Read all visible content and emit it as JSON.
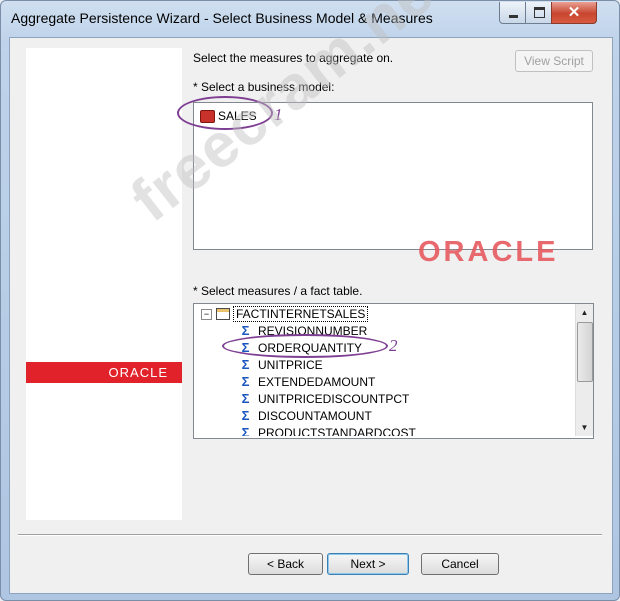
{
  "window": {
    "title": "Aggregate Persistence Wizard - Select Business Model & Measures",
    "controls": {
      "minimize": "minimize-icon",
      "maximize": "maximize-icon",
      "close": "close-icon"
    }
  },
  "left_panel": {
    "brand": "ORACLE",
    "brand_color": "#e2222a"
  },
  "main": {
    "instruction": "Select the measures to aggregate on.",
    "view_script_label": "View Script",
    "business_model_label": "* Select a business model:",
    "business_models": [
      "SALES"
    ],
    "measures_label": "* Select measures / a fact table.",
    "fact_table": "FACTINTERNETSALES",
    "measures": [
      "REVISIONNUMBER",
      "ORDERQUANTITY",
      "UNITPRICE",
      "EXTENDEDAMOUNT",
      "UNITPRICEDISCOUNTPCT",
      "DISCOUNTAMOUNT",
      "PRODUCTSTANDARDCOST"
    ]
  },
  "annotations": {
    "one": "1",
    "two": "2",
    "color": "#7e3f93"
  },
  "watermarks": {
    "site": "freecram.net",
    "brand": "ORACLE"
  },
  "buttons": {
    "back": "< Back",
    "next": "Next >",
    "cancel": "Cancel"
  }
}
